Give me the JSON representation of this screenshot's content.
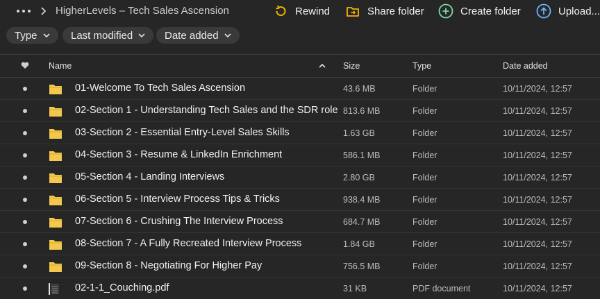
{
  "breadcrumb": {
    "title": "HigherLevels – Tech Sales Ascension"
  },
  "actions": {
    "rewind": "Rewind",
    "share_folder": "Share folder",
    "create_folder": "Create folder",
    "upload": "Upload..."
  },
  "filters": {
    "type": "Type",
    "last_modified": "Last modified",
    "date_added": "Date added"
  },
  "columns": {
    "name": "Name",
    "size": "Size",
    "type": "Type",
    "date_added": "Date added"
  },
  "colors": {
    "accent_yellow": "#f5b400",
    "accent_green": "#7ed7a8",
    "accent_blue": "#6ab4ff",
    "folder": "#f2c94c"
  },
  "rows": [
    {
      "name": "01-Welcome To Tech Sales Ascension",
      "size": "43.6 MB",
      "type": "Folder",
      "date": "10/11/2024, 12:57",
      "icon": "folder-icon"
    },
    {
      "name": "02-Section 1 - Understanding Tech Sales and the SDR role",
      "size": "813.6 MB",
      "type": "Folder",
      "date": "10/11/2024, 12:57",
      "icon": "folder-icon"
    },
    {
      "name": "03-Section 2 - Essential Entry-Level Sales Skills",
      "size": "1.63 GB",
      "type": "Folder",
      "date": "10/11/2024, 12:57",
      "icon": "folder-icon"
    },
    {
      "name": "04-Section 3 - Resume & LinkedIn Enrichment",
      "size": "586.1 MB",
      "type": "Folder",
      "date": "10/11/2024, 12:57",
      "icon": "folder-icon"
    },
    {
      "name": "05-Section 4 - Landing Interviews",
      "size": "2.80 GB",
      "type": "Folder",
      "date": "10/11/2024, 12:57",
      "icon": "folder-icon"
    },
    {
      "name": "06-Section 5 - Interview Process Tips & Tricks",
      "size": "938.4 MB",
      "type": "Folder",
      "date": "10/11/2024, 12:57",
      "icon": "folder-icon"
    },
    {
      "name": "07-Section 6 - Crushing The Interview Process",
      "size": "684.7 MB",
      "type": "Folder",
      "date": "10/11/2024, 12:57",
      "icon": "folder-icon"
    },
    {
      "name": "08-Section 7 - A Fully Recreated Interview Process",
      "size": "1.84 GB",
      "type": "Folder",
      "date": "10/11/2024, 12:57",
      "icon": "folder-icon"
    },
    {
      "name": "09-Section 8 - Negotiating For Higher Pay",
      "size": "756.5 MB",
      "type": "Folder",
      "date": "10/11/2024, 12:57",
      "icon": "folder-icon"
    },
    {
      "name": "02-1-1_Couching.pdf",
      "size": "31 KB",
      "type": "PDF document",
      "date": "10/11/2024, 12:57",
      "icon": "pdf-file-icon"
    }
  ]
}
